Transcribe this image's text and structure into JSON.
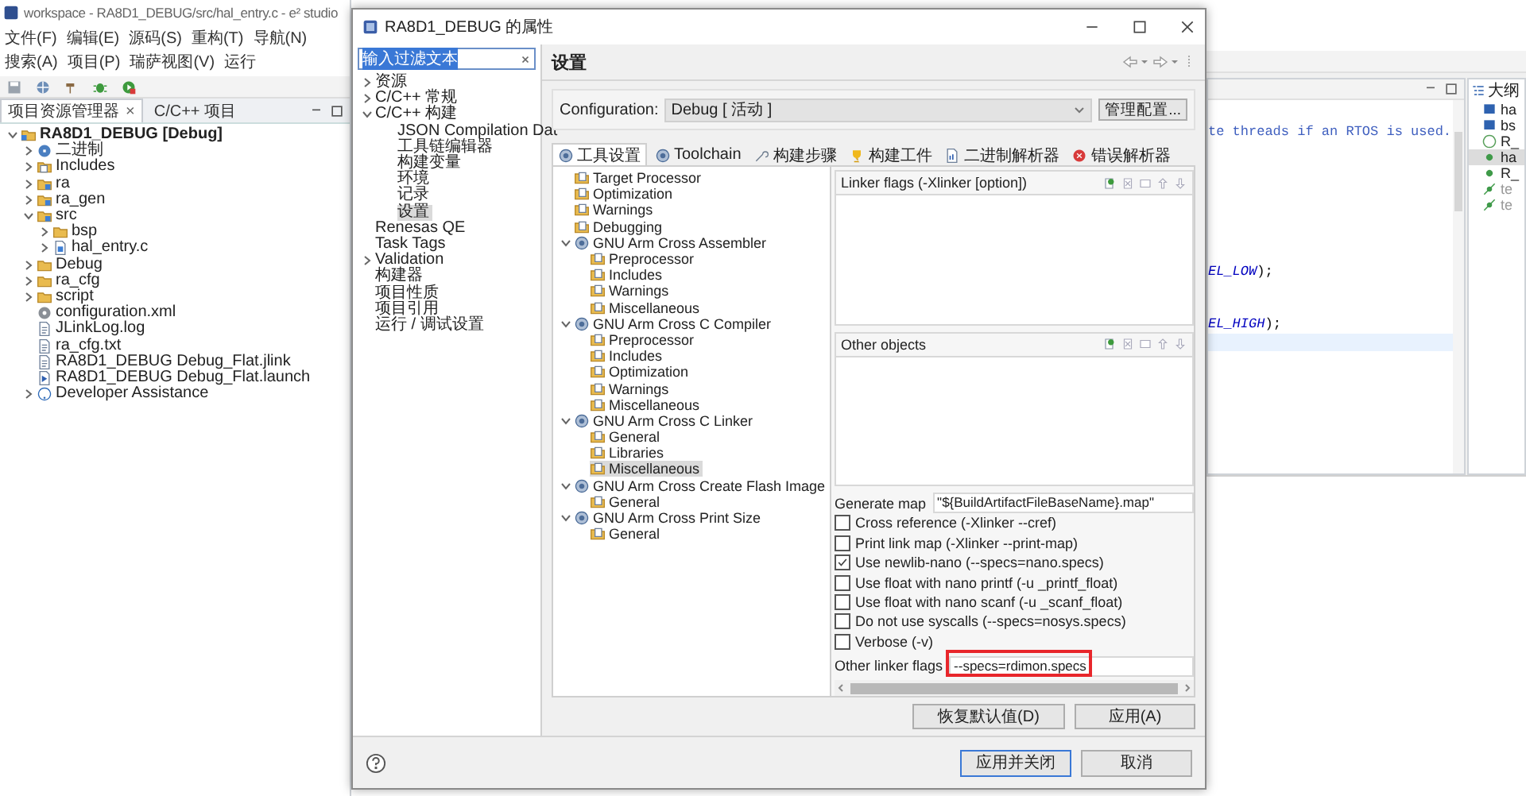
{
  "ide": {
    "title": "workspace - RA8D1_DEBUG/src/hal_entry.c - e² studio",
    "menu": [
      "文件(F)",
      "编辑(E)",
      "源码(S)",
      "重构(T)",
      "导航(N)",
      "搜索(A)",
      "项目(P)",
      "瑞萨视图(V)",
      "运行"
    ],
    "views": [
      {
        "label": "项目资源管理器",
        "close": "×",
        "selected": true
      },
      {
        "label": "C/C++ 项目",
        "selected": false
      }
    ],
    "tree": [
      {
        "label": "RA8D1_DEBUG [Debug]",
        "kind": "project",
        "expanded": true,
        "children": [
          {
            "label": "二进制",
            "kind": "binary",
            "expanded": false
          },
          {
            "label": "Includes",
            "kind": "includes",
            "expanded": false
          },
          {
            "label": "ra",
            "kind": "folder-src",
            "expanded": false
          },
          {
            "label": "ra_gen",
            "kind": "folder-src",
            "expanded": false
          },
          {
            "label": "src",
            "kind": "folder-src",
            "expanded": true,
            "children": [
              {
                "label": "bsp",
                "kind": "folder",
                "expanded": false
              },
              {
                "label": "hal_entry.c",
                "kind": "file-c",
                "expanded": false
              }
            ]
          },
          {
            "label": "Debug",
            "kind": "folder",
            "expanded": false
          },
          {
            "label": "ra_cfg",
            "kind": "folder",
            "expanded": false
          },
          {
            "label": "script",
            "kind": "folder",
            "expanded": false
          },
          {
            "label": "configuration.xml",
            "kind": "config"
          },
          {
            "label": "JLinkLog.log",
            "kind": "file"
          },
          {
            "label": "ra_cfg.txt",
            "kind": "file"
          },
          {
            "label": "RA8D1_DEBUG Debug_Flat.jlink",
            "kind": "file"
          },
          {
            "label": "RA8D1_DEBUG Debug_Flat.launch",
            "kind": "launch"
          },
          {
            "label": "Developer Assistance",
            "kind": "help",
            "expanded": false
          }
        ]
      }
    ]
  },
  "dialog": {
    "title": "RA8D1_DEBUG 的属性",
    "filter": "输入过滤文本",
    "nav": [
      {
        "label": "资源",
        "expanded": false,
        "selected": false
      },
      {
        "label": "C/C++ 常规",
        "expanded": false,
        "selected": false
      },
      {
        "label": "C/C++ 构建",
        "expanded": true,
        "selected": false,
        "children": [
          {
            "label": "JSON Compilation Dat",
            "selected": false
          },
          {
            "label": "工具链编辑器",
            "selected": false
          },
          {
            "label": "构建变量",
            "selected": false
          },
          {
            "label": "环境",
            "selected": false
          },
          {
            "label": "记录",
            "selected": false
          },
          {
            "label": "设置",
            "selected": true
          }
        ]
      },
      {
        "label": "Renesas QE",
        "selected": false
      },
      {
        "label": "Task Tags",
        "selected": false
      },
      {
        "label": "Validation",
        "expanded": false,
        "selected": false
      },
      {
        "label": "构建器",
        "selected": false
      },
      {
        "label": "项目性质",
        "selected": false
      },
      {
        "label": "项目引用",
        "selected": false
      },
      {
        "label": "运行 / 调试设置",
        "selected": false
      }
    ],
    "page_title": "设置",
    "configuration": {
      "label": "Configuration:",
      "value": "Debug [ 活动 ]",
      "button": "管理配置..."
    },
    "tabs": [
      {
        "label": "工具设置",
        "kind": "tool",
        "selected": true
      },
      {
        "label": "Toolchain",
        "kind": "tool",
        "selected": false
      },
      {
        "label": "构建步骤",
        "kind": "steps",
        "selected": false
      },
      {
        "label": "构建工件",
        "kind": "artifact",
        "selected": false
      },
      {
        "label": "二进制解析器",
        "kind": "binparser",
        "selected": false
      },
      {
        "label": "错误解析器",
        "kind": "error",
        "selected": false
      }
    ],
    "settings_tree": [
      {
        "label": "Target Processor",
        "kind": "page",
        "selected": false
      },
      {
        "label": "Optimization",
        "kind": "page",
        "selected": false
      },
      {
        "label": "Warnings",
        "kind": "page",
        "selected": false
      },
      {
        "label": "Debugging",
        "kind": "page",
        "selected": false
      },
      {
        "label": "GNU Arm Cross Assembler",
        "kind": "tool",
        "expanded": true,
        "selected": false,
        "children": [
          {
            "label": "Preprocessor",
            "kind": "page",
            "selected": false
          },
          {
            "label": "Includes",
            "kind": "page",
            "selected": false
          },
          {
            "label": "Warnings",
            "kind": "page",
            "selected": false
          },
          {
            "label": "Miscellaneous",
            "kind": "page",
            "selected": false
          }
        ]
      },
      {
        "label": "GNU Arm Cross C Compiler",
        "kind": "tool",
        "expanded": true,
        "selected": false,
        "children": [
          {
            "label": "Preprocessor",
            "kind": "page",
            "selected": false
          },
          {
            "label": "Includes",
            "kind": "page",
            "selected": false
          },
          {
            "label": "Optimization",
            "kind": "page",
            "selected": false
          },
          {
            "label": "Warnings",
            "kind": "page",
            "selected": false
          },
          {
            "label": "Miscellaneous",
            "kind": "page",
            "selected": false
          }
        ]
      },
      {
        "label": "GNU Arm Cross C Linker",
        "kind": "tool",
        "expanded": true,
        "selected": false,
        "children": [
          {
            "label": "General",
            "kind": "page",
            "selected": false
          },
          {
            "label": "Libraries",
            "kind": "page",
            "selected": false
          },
          {
            "label": "Miscellaneous",
            "kind": "page",
            "selected": true
          }
        ]
      },
      {
        "label": "GNU Arm Cross Create Flash Image",
        "kind": "tool",
        "expanded": true,
        "selected": false,
        "children": [
          {
            "label": "General",
            "kind": "page",
            "selected": false
          }
        ]
      },
      {
        "label": "GNU Arm Cross Print Size",
        "kind": "tool",
        "expanded": true,
        "selected": false,
        "children": [
          {
            "label": "General",
            "kind": "page",
            "selected": false
          }
        ]
      }
    ],
    "lists": [
      {
        "label": "Linker flags (-Xlinker [option])"
      },
      {
        "label": "Other objects"
      }
    ],
    "generate_map": {
      "label": "Generate map",
      "value": "\"${BuildArtifactFileBaseName}.map\""
    },
    "options": [
      {
        "label": "Cross reference (-Xlinker --cref)",
        "checked": false
      },
      {
        "label": "Print link map (-Xlinker --print-map)",
        "checked": false
      },
      {
        "label": "Use newlib-nano (--specs=nano.specs)",
        "checked": true
      },
      {
        "label": "Use float with nano printf (-u _printf_float)",
        "checked": false
      },
      {
        "label": "Use float with nano scanf (-u _scanf_float)",
        "checked": false
      },
      {
        "label": "Do not use syscalls (--specs=nosys.specs)",
        "checked": false
      },
      {
        "label": "Verbose (-v)",
        "checked": false
      }
    ],
    "other_flags": {
      "label": "Other linker flags",
      "value": "--specs=rdimon.specs",
      "highlighted": true
    },
    "buttons": [
      "恢复默认值(D)",
      "应用(A)"
    ],
    "footer_buttons": [
      "应用并关闭",
      "取消"
    ]
  },
  "editor": {
    "lines": [
      {
        "text": "te threads if an RTOS is used.",
        "kind": "comment"
      },
      {
        "text": "*EL_LOW*);",
        "kind": "code"
      },
      {
        "text": "*EL_HIGH*);",
        "kind": "code"
      }
    ]
  },
  "outline": {
    "title": "大纲",
    "items": [
      {
        "label": "ha",
        "kind": "include",
        "selected": false
      },
      {
        "label": "bs",
        "kind": "include",
        "selected": false
      },
      {
        "label": "R_",
        "kind": "macro",
        "selected": false
      },
      {
        "label": "ha",
        "kind": "function",
        "selected": true
      },
      {
        "label": "R_",
        "kind": "function",
        "selected": false
      },
      {
        "label": "te",
        "kind": "variable",
        "selected": false
      },
      {
        "label": "te",
        "kind": "variable",
        "selected": false
      }
    ]
  }
}
